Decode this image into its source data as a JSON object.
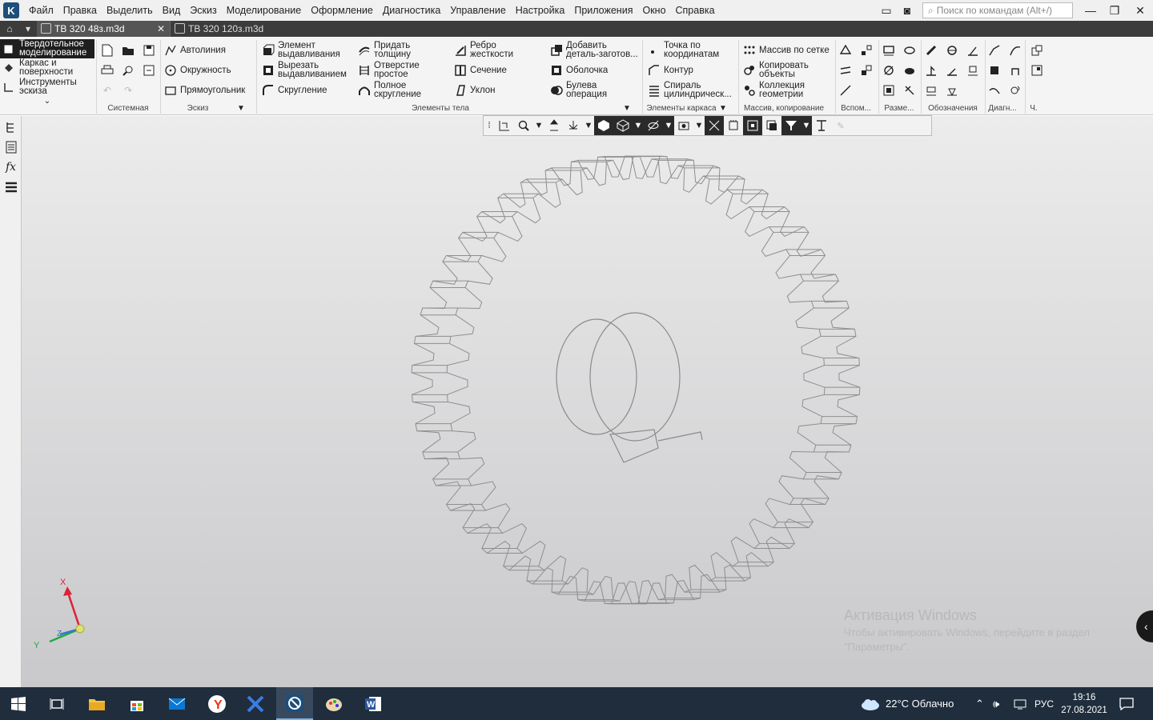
{
  "menu": {
    "items": [
      "Файл",
      "Правка",
      "Выделить",
      "Вид",
      "Эскиз",
      "Моделирование",
      "Оформление",
      "Диагностика",
      "Управление",
      "Настройка",
      "Приложения",
      "Окно",
      "Справка"
    ],
    "search_placeholder": "Поиск по командам (Alt+/)"
  },
  "tabs": [
    {
      "label": "ТВ 320 48з.m3d",
      "active": true
    },
    {
      "label": "ТВ 320 120з.m3d",
      "active": false
    }
  ],
  "modes": [
    {
      "label_1": "Твердотельное",
      "label_2": "моделирование",
      "active": true
    },
    {
      "label_1": "Каркас и",
      "label_2": "поверхности",
      "active": false
    },
    {
      "label_1": "Инструменты",
      "label_2": "эскиза",
      "active": false
    }
  ],
  "groups": {
    "system": "Системная",
    "sketch": "Эскиз",
    "body": "Элементы тела",
    "frame": "Элементы каркаса",
    "array": "Массив, копирование",
    "aux": "Вспом...",
    "dims": "Разме...",
    "marks": "Обозначения",
    "diag": "Диагн...",
    "ch": "Ч."
  },
  "sketch_buttons": [
    "Автолиния",
    "Окружность",
    "Прямоугольник"
  ],
  "body_buttons": {
    "extrude_1": "Элемент",
    "extrude_2": "выдавливания",
    "cut_1": "Вырезать",
    "cut_2": "выдавливанием",
    "fillet": "Скругление",
    "thick_1": "Придать",
    "thick_2": "толщину",
    "hole_1": "Отверстие",
    "hole_2": "простое",
    "full_1": "Полное",
    "full_2": "скругление",
    "rib_1": "Ребро",
    "rib_2": "жесткости",
    "section": "Сечение",
    "draft": "Уклон",
    "add_1": "Добавить",
    "add_2": "деталь-заготов...",
    "shell": "Оболочка",
    "bool_1": "Булева",
    "bool_2": "операция"
  },
  "frame_buttons": {
    "point_1": "Точка по",
    "point_2": "координатам",
    "contour": "Контур",
    "spiral_1": "Спираль",
    "spiral_2": "цилиндрическ..."
  },
  "array_buttons": {
    "grid": "Массив по сетке",
    "copy_1": "Копировать",
    "copy_2": "объекты",
    "coll_1": "Коллекция",
    "coll_2": "геометрии"
  },
  "axes": {
    "x": "X",
    "y": "Y",
    "z": "Z"
  },
  "watermark": {
    "title": "Активация Windows",
    "line1": "Чтобы активировать Windows, перейдите в раздел",
    "line2": "\"Параметры\"."
  },
  "tray": {
    "weather": "22°C  Облачно",
    "lang": "РУС",
    "time": "19:16",
    "date": "27.08.2021"
  },
  "colors": {
    "accent": "#1e1e1e",
    "taskbar": "#1f2d3d"
  }
}
